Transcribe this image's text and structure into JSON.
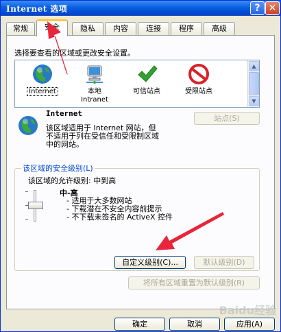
{
  "window": {
    "title": "Internet 选项",
    "help": "?",
    "close": "✕"
  },
  "tabs": [
    "常规",
    "安全",
    "隐私",
    "内容",
    "连接",
    "程序",
    "高级"
  ],
  "prompt": "选择要查看的区域或更改安全设置。",
  "zones": [
    {
      "label": "Internet",
      "icon": "globe-icon"
    },
    {
      "label": "本地\nIntranet",
      "icon": "computer-network-icon"
    },
    {
      "label": "可信站点",
      "icon": "checkmark-icon"
    },
    {
      "label": "受限站点",
      "icon": "restricted-icon"
    }
  ],
  "selected_zone": {
    "title": "Internet",
    "desc_line1": "该区域适用于 Internet 网站，但",
    "desc_line2": "不适用于列在受信任和受限制区域",
    "desc_line3": "中的网站。",
    "sites_button": "站点(S)"
  },
  "security_level": {
    "legend": "该区域的安全级别(L)",
    "allowed": "该区域的允许级别: 中到高",
    "level": "中-高",
    "bullets": [
      "适用于大多数网站",
      "下载潜在不安全内容前提示",
      "不下载未签名的 ActiveX 控件"
    ],
    "custom_button": "自定义级别(C)...",
    "default_button": "默认级别(D)"
  },
  "reset_all_button": "将所有区域重置为默认级别(R)",
  "footer": {
    "ok": "确定",
    "cancel": "取消",
    "apply": "应用(A)"
  },
  "watermark": "Baidu经验",
  "colors": {
    "title_bar": "#0a5fe0",
    "arrow": "#e8253a",
    "legend": "#0046d5"
  }
}
